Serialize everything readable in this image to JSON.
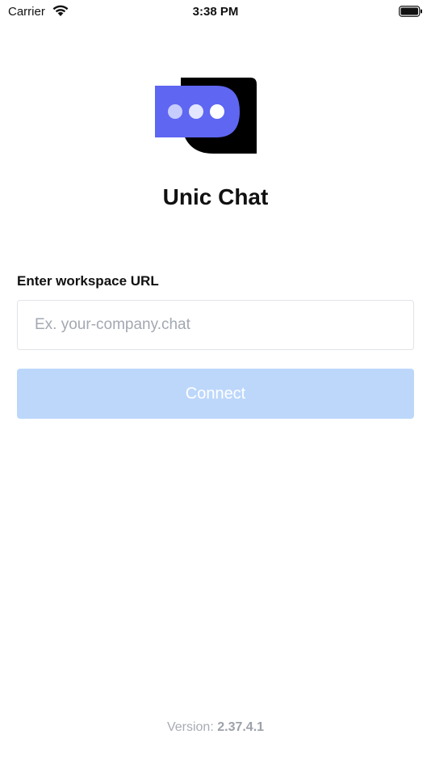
{
  "status_bar": {
    "carrier": "Carrier",
    "time": "3:38 PM",
    "wifi_icon": "wifi-icon",
    "battery_icon": "battery-full-icon"
  },
  "logo": {
    "icon": "chat-bubble-logo-icon",
    "primary_color": "#5e66f2",
    "dot_colors": [
      "#c7ccff",
      "#e3e6ff",
      "#ffffff"
    ],
    "shadow_color": "#000000"
  },
  "app": {
    "title": "Unic Chat"
  },
  "form": {
    "label": "Enter workspace URL",
    "input_value": "",
    "input_placeholder": "Ex. your-company.chat",
    "connect_label": "Connect",
    "connect_bg_color": "#bdd7fb",
    "connect_text_color": "#ffffff"
  },
  "footer": {
    "version_prefix": "Version: ",
    "version_number": "2.37.4.1"
  }
}
